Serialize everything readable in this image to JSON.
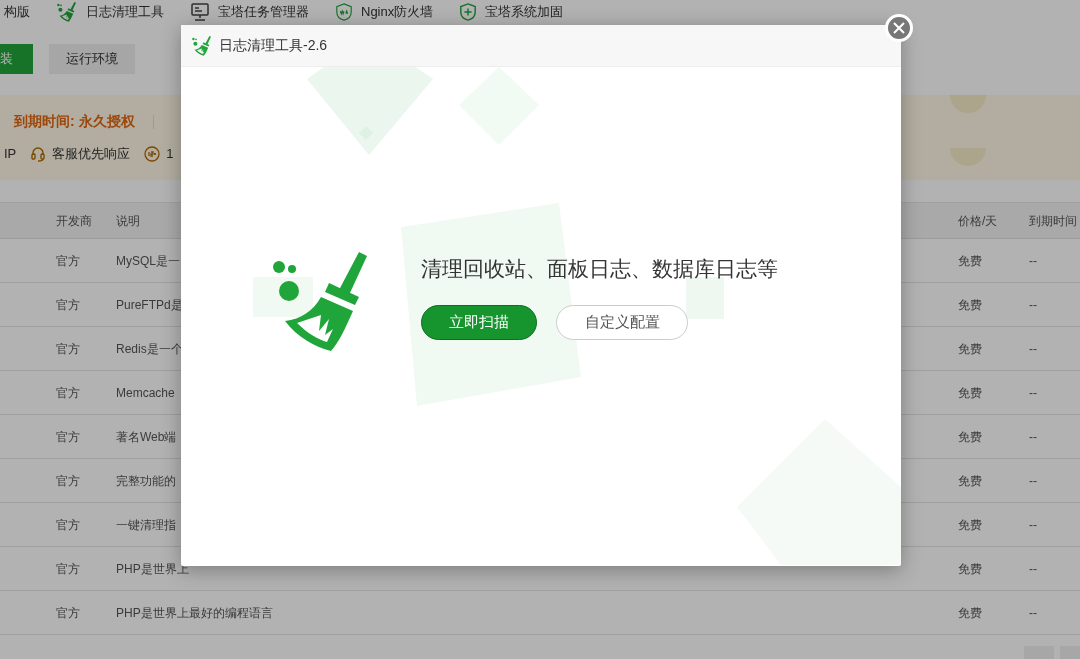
{
  "top_nav": [
    {
      "label": "构版"
    },
    {
      "label": "日志清理工具"
    },
    {
      "label": "宝塔任务管理器"
    },
    {
      "label": "Nginx防火墙"
    },
    {
      "label": "宝塔系统加固"
    }
  ],
  "action_buttons": [
    {
      "label": "装",
      "selected": true
    },
    {
      "label": "运行环境",
      "selected": false
    }
  ],
  "banner": {
    "expiry": "到期时间: 永久授权",
    "perks": [
      "IP",
      "客服优先响应",
      "1"
    ]
  },
  "table": {
    "columns": [
      "开发商",
      "说明",
      "价格/天",
      "到期时间"
    ],
    "rows": [
      {
        "developer": "官方",
        "description": "MySQL是一",
        "price": "免费",
        "expiry": "--"
      },
      {
        "developer": "官方",
        "description": "PureFTPd是",
        "price": "免费",
        "expiry": "--"
      },
      {
        "developer": "官方",
        "description": "Redis是一个",
        "price": "免费",
        "expiry": "--"
      },
      {
        "developer": "官方",
        "description": "Memcache",
        "price": "免费",
        "expiry": "--"
      },
      {
        "developer": "官方",
        "description": "著名Web端",
        "price": "免费",
        "expiry": "--"
      },
      {
        "developer": "官方",
        "description": "完整功能的",
        "price": "免费",
        "expiry": "--"
      },
      {
        "developer": "官方",
        "description": "一键清理指",
        "price": "免费",
        "expiry": "--"
      },
      {
        "developer": "官方",
        "description": "PHP是世界上",
        "price": "免费",
        "expiry": "--"
      },
      {
        "developer": "官方",
        "description": "PHP是世界上最好的编程语言",
        "price": "免费",
        "expiry": "--"
      }
    ]
  },
  "dialog": {
    "title": "日志清理工具-2.6",
    "message": "清理回收站、面板日志、数据库日志等",
    "buttons": [
      {
        "label": "立即扫描",
        "kind": "primary"
      },
      {
        "label": "自定义配置",
        "kind": "secondary"
      }
    ]
  }
}
